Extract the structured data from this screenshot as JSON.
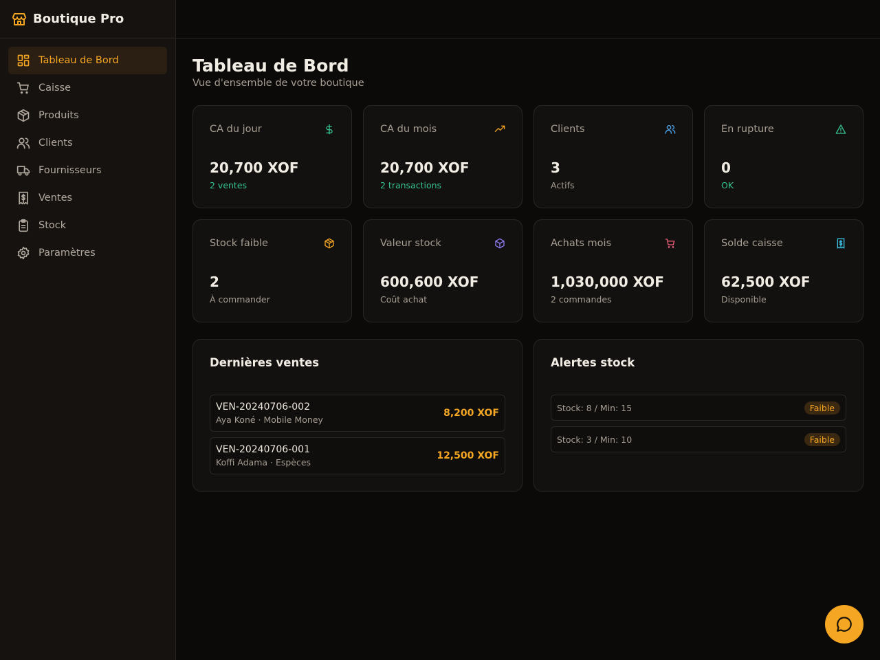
{
  "app": {
    "name": "Boutique Pro",
    "accent": "#f5a623"
  },
  "sidebar": {
    "items": [
      {
        "label": "Tableau de Bord",
        "icon": "dashboard-icon",
        "active": true
      },
      {
        "label": "Caisse",
        "icon": "cart-icon"
      },
      {
        "label": "Produits",
        "icon": "box-icon"
      },
      {
        "label": "Clients",
        "icon": "users-icon"
      },
      {
        "label": "Fournisseurs",
        "icon": "truck-icon"
      },
      {
        "label": "Ventes",
        "icon": "receipt-icon"
      },
      {
        "label": "Stock",
        "icon": "clipboard-icon"
      },
      {
        "label": "Paramètres",
        "icon": "gear-icon"
      }
    ]
  },
  "page": {
    "title": "Tableau de Bord",
    "subtitle": "Vue d'ensemble de votre boutique"
  },
  "stats": [
    {
      "label": "CA du jour",
      "value": "20,700 XOF",
      "sub": "2 ventes",
      "icon": "dollar-icon",
      "icon_color": "#34c38f"
    },
    {
      "label": "CA du mois",
      "value": "20,700 XOF",
      "sub": "2 transactions",
      "icon": "trending-up-icon",
      "icon_color": "#f5a623"
    },
    {
      "label": "Clients",
      "value": "3",
      "sub": "Actifs",
      "icon": "users-icon",
      "icon_color": "#4ea8f0"
    },
    {
      "label": "En rupture",
      "value": "0",
      "sub": "OK",
      "icon": "warning-icon",
      "icon_color": "#34c38f"
    },
    {
      "label": "Stock faible",
      "value": "2",
      "sub": "À commander",
      "icon": "box-icon",
      "icon_color": "#f5a623"
    },
    {
      "label": "Valeur stock",
      "value": "600,600 XOF",
      "sub": "Coût achat",
      "icon": "box-icon",
      "icon_color": "#8e7cf0"
    },
    {
      "label": "Achats mois",
      "value": "1,030,000 XOF",
      "sub": "2 commandes",
      "icon": "cart-icon",
      "icon_color": "#f0607a"
    },
    {
      "label": "Solde caisse",
      "value": "62,500 XOF",
      "sub": "Disponible",
      "icon": "receipt-icon",
      "icon_color": "#3bbfe0"
    }
  ],
  "recent_sales": {
    "title": "Dernières ventes",
    "items": [
      {
        "ref": "VEN-20240706-002",
        "meta": "Aya Koné · Mobile Money",
        "amount": "8,200 XOF"
      },
      {
        "ref": "VEN-20240706-001",
        "meta": "Koffi Adama · Espèces",
        "amount": "12,500 XOF"
      }
    ]
  },
  "stock_alerts": {
    "title": "Alertes stock",
    "items": [
      {
        "text": "Stock: 8 / Min: 15",
        "badge": "Faible"
      },
      {
        "text": "Stock: 3 / Min: 10",
        "badge": "Faible"
      }
    ]
  },
  "chat": {
    "icon": "chat-icon"
  }
}
